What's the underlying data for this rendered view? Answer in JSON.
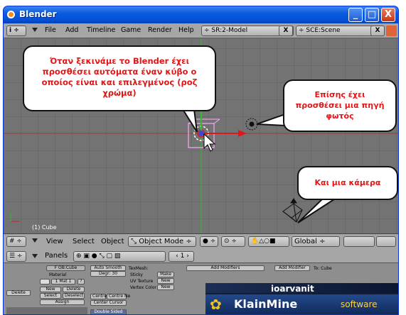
{
  "window": {
    "title": "Blender",
    "controls": [
      "_",
      "□",
      "X"
    ]
  },
  "menu": {
    "info_button": "i",
    "items": [
      "File",
      "Add",
      "Timeline",
      "Game",
      "Render",
      "Help"
    ],
    "screen_select": "SR:2-Model",
    "screen_close": "X",
    "scene_select": "SCE:Scene",
    "scene_close": "X"
  },
  "viewport": {
    "object_label": "(1) Cube",
    "callouts": [
      "Όταν ξεκινάμε το Blender έχει προσθέσει αυτόματα έναν κύβο ο οποίος είναι και επιλεγμένος (ροζ χρώμα)",
      "Επίσης έχει προσθέσει μια πηγή φωτός",
      "Και μια κάμερα"
    ],
    "colors": {
      "x_axis": "#e21616",
      "y_axis": "#2dbf2d",
      "selection": "#f8a8f8",
      "callout_text": "#e21616"
    }
  },
  "view_header": {
    "view": "View",
    "select": "Select",
    "object": "Object",
    "mode": "Object Mode",
    "orientation": "Global"
  },
  "buttons_window": {
    "header": {
      "panels": "Panels",
      "frame": "1"
    },
    "link": {
      "ob": "F  OB:Cube",
      "material": "Material",
      "mat_slot": "1 Mat 1",
      "question": "?",
      "delete": "Delete",
      "new": "New",
      "delete2": "Delete",
      "select": "Select",
      "deselect": "Deselect",
      "assign": "Assign"
    },
    "mesh": {
      "auto_smooth": "Auto Smooth",
      "degr": "Degr: 30",
      "center": "Centre",
      "center_new": "Centre Ne",
      "center_cursor": "Center Cursor",
      "double_sided": "Double Sided"
    },
    "texmesh": {
      "label": "TexMesh:",
      "sticky": "Sticky",
      "make": "Make",
      "uv": "UV Texture",
      "new1": "New",
      "vc": "Vertex Color",
      "new2": "New"
    },
    "modifiers": {
      "add": "Add Modifiers",
      "add_modifier": "Add Modifier",
      "to": "To: Cube"
    }
  },
  "logo": {
    "name": "ioarvanit",
    "brand": "KlainMine",
    "suffix": "software"
  }
}
